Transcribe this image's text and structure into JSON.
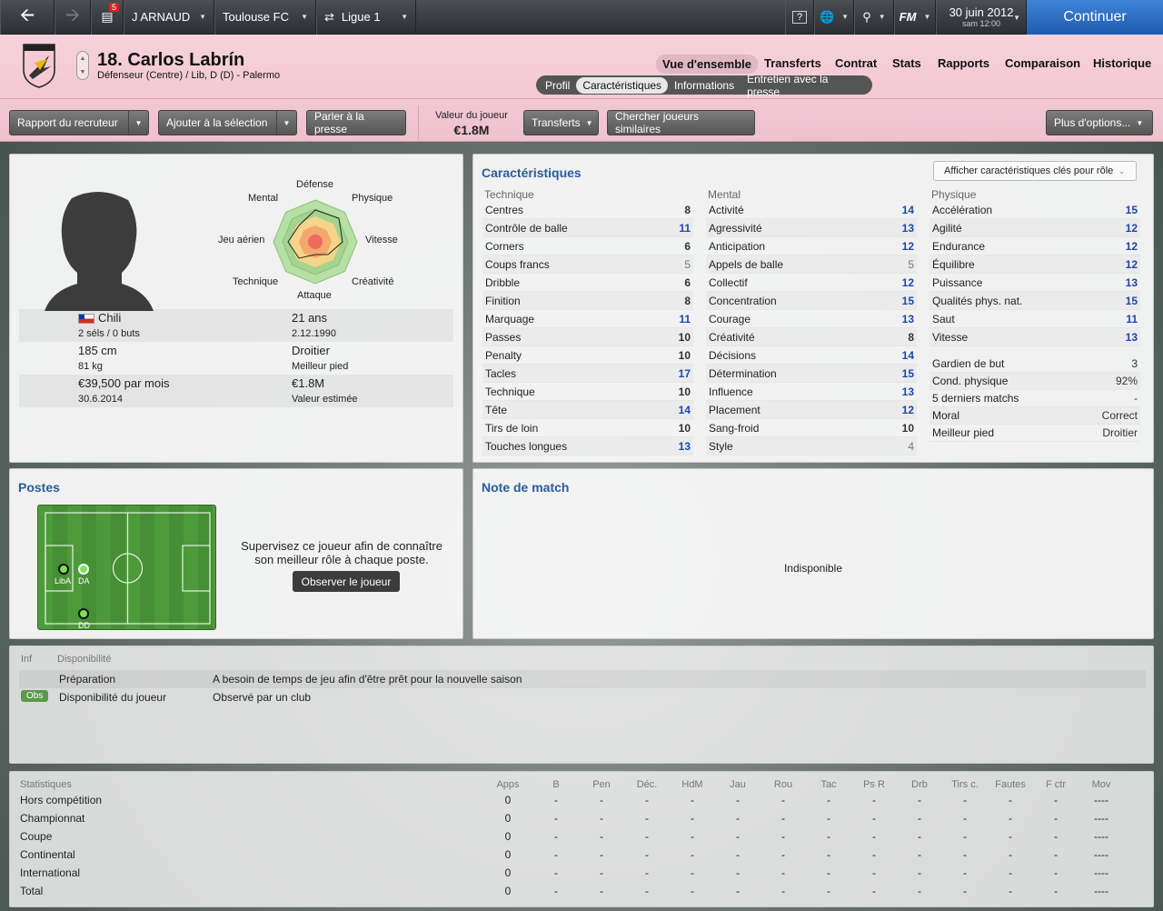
{
  "topbar": {
    "manager": "J ARNAUD",
    "club": "Toulouse FC",
    "league": "Ligue 1",
    "badge": "5",
    "date": "30 juin 2012",
    "time": "sam 12:00",
    "continue": "Continuer",
    "fm_logo": "FM"
  },
  "player": {
    "number_name": "18. Carlos Labrín",
    "position": "Défenseur (Centre) / Lib, D (D) - Palermo"
  },
  "nav": {
    "items": [
      "Vue d'ensemble",
      "Transferts",
      "Contrat",
      "Stats",
      "Rapports",
      "Comparaison",
      "Historique"
    ],
    "sub": [
      "Profil",
      "Caractéristiques",
      "Informations",
      "Entretien avec la presse"
    ]
  },
  "actions": {
    "rapport": "Rapport du recruteur",
    "ajouter": "Ajouter à la sélection",
    "presse": "Parler à la presse",
    "valeur_label": "Valeur du joueur",
    "valeur": "€1.8M",
    "transferts": "Transferts",
    "chercher": "Chercher joueurs similaires",
    "plus": "Plus d'options..."
  },
  "radar": {
    "labels": {
      "top": "Défense",
      "tr": "Physique",
      "r": "Vitesse",
      "br": "Créativité",
      "b": "Attaque",
      "bl": "Technique",
      "l": "Jeu aérien",
      "tl": "Mental"
    }
  },
  "profile": {
    "nation": "Chili",
    "caps": "2 séls / 0 buts",
    "age": "21 ans",
    "dob": "2.12.1990",
    "height": "185 cm",
    "weight": "81 kg",
    "foot": "Droitier",
    "foot_label": "Meilleur pied",
    "wage": "€39,500 par mois",
    "contract": "30.6.2014",
    "value": "€1.8M",
    "value_label": "Valeur estimée"
  },
  "attributes": {
    "title": "Caractéristiques",
    "button": "Afficher caractéristiques clés pour rôle",
    "technique_h": "Technique",
    "mental_h": "Mental",
    "physique_h": "Physique",
    "technique": [
      [
        "Centres",
        "8"
      ],
      [
        "Contrôle de balle",
        "11"
      ],
      [
        "Corners",
        "6"
      ],
      [
        "Coups francs",
        "5"
      ],
      [
        "Dribble",
        "6"
      ],
      [
        "Finition",
        "8"
      ],
      [
        "Marquage",
        "11"
      ],
      [
        "Passes",
        "10"
      ],
      [
        "Penalty",
        "10"
      ],
      [
        "Tacles",
        "17"
      ],
      [
        "Technique",
        "10"
      ],
      [
        "Tête",
        "14"
      ],
      [
        "Tirs de loin",
        "10"
      ],
      [
        "Touches longues",
        "13"
      ]
    ],
    "mental": [
      [
        "Activité",
        "14"
      ],
      [
        "Agressivité",
        "13"
      ],
      [
        "Anticipation",
        "12"
      ],
      [
        "Appels de balle",
        "5"
      ],
      [
        "Collectif",
        "12"
      ],
      [
        "Concentration",
        "15"
      ],
      [
        "Courage",
        "13"
      ],
      [
        "Créativité",
        "8"
      ],
      [
        "Décisions",
        "14"
      ],
      [
        "Détermination",
        "15"
      ],
      [
        "Influence",
        "13"
      ],
      [
        "Placement",
        "12"
      ],
      [
        "Sang-froid",
        "10"
      ],
      [
        "Style",
        "4"
      ]
    ],
    "physique": [
      [
        "Accélération",
        "15"
      ],
      [
        "Agilité",
        "12"
      ],
      [
        "Endurance",
        "12"
      ],
      [
        "Équilibre",
        "12"
      ],
      [
        "Puissance",
        "13"
      ],
      [
        "Qualités phys. nat.",
        "15"
      ],
      [
        "Saut",
        "11"
      ],
      [
        "Vitesse",
        "13"
      ]
    ],
    "extra": [
      [
        "Gardien de but",
        "3"
      ],
      [
        "Cond. physique",
        "92%"
      ],
      [
        "5 derniers matchs",
        "-"
      ],
      [
        "Moral",
        "Correct"
      ],
      [
        "Meilleur pied",
        "Droitier"
      ]
    ]
  },
  "postes": {
    "title": "Postes",
    "text1": "Supervisez ce joueur afin de connaître",
    "text2": "son meilleur rôle à chaque poste.",
    "button": "Observer le joueur",
    "pos": [
      "LibA",
      "DA",
      "DD"
    ]
  },
  "note": {
    "title": "Note de match",
    "value": "Indisponible"
  },
  "dispo": {
    "h1": "Inf",
    "h2": "Disponibilité",
    "rows": [
      [
        "",
        "Préparation",
        "A besoin de temps de jeu afin d'être prêt pour la nouvelle saison"
      ],
      [
        "Obs",
        "Disponibilité du joueur",
        "Observé par un club"
      ]
    ]
  },
  "stats": {
    "headers": [
      "Statistiques",
      "Apps",
      "B",
      "Pen",
      "Déc.",
      "HdM",
      "Jau",
      "Rou",
      "Tac",
      "Ps R",
      "Drb",
      "Tirs c.",
      "Fautes",
      "F ctr",
      "Mov"
    ],
    "rows": [
      [
        "Hors compétition",
        "0",
        "-",
        "-",
        "-",
        "-",
        "-",
        "-",
        "-",
        "-",
        "-",
        "-",
        "-",
        "-",
        "----"
      ],
      [
        "Championnat",
        "0",
        "-",
        "-",
        "-",
        "-",
        "-",
        "-",
        "-",
        "-",
        "-",
        "-",
        "-",
        "-",
        "----"
      ],
      [
        "Coupe",
        "0",
        "-",
        "-",
        "-",
        "-",
        "-",
        "-",
        "-",
        "-",
        "-",
        "-",
        "-",
        "-",
        "----"
      ],
      [
        "Continental",
        "0",
        "-",
        "-",
        "-",
        "-",
        "-",
        "-",
        "-",
        "-",
        "-",
        "-",
        "-",
        "-",
        "----"
      ],
      [
        "International",
        "0",
        "-",
        "-",
        "-",
        "-",
        "-",
        "-",
        "-",
        "-",
        "-",
        "-",
        "-",
        "-",
        "----"
      ],
      [
        "Total",
        "0",
        "-",
        "-",
        "-",
        "-",
        "-",
        "-",
        "-",
        "-",
        "-",
        "-",
        "-",
        "-",
        "----"
      ]
    ]
  }
}
